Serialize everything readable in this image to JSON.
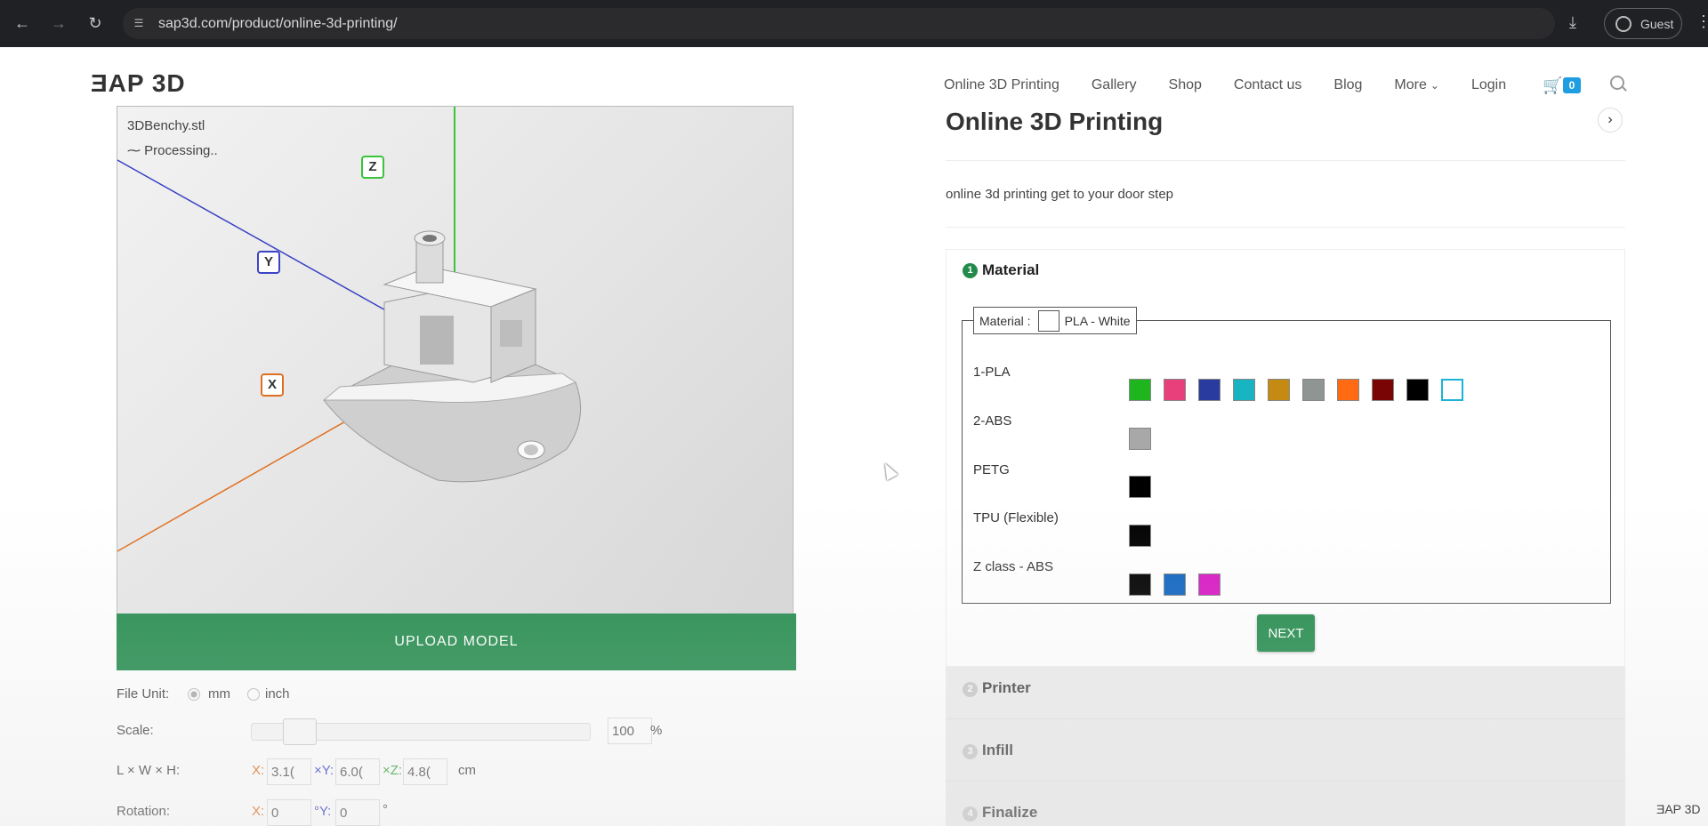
{
  "browser": {
    "url": "sap3d.com/product/online-3d-printing/",
    "profile_label": "Guest"
  },
  "site": {
    "logo": "ƎAP 3D",
    "nav": [
      "Online 3D Printing",
      "Gallery",
      "Shop",
      "Contact us",
      "Blog",
      "More",
      "Login"
    ],
    "cart_count": "0",
    "watermark": "ƎAP 3D"
  },
  "viewer": {
    "file_name": "3DBenchy.stl",
    "status": "Processing..",
    "axis_x": "X",
    "axis_y": "Y",
    "axis_z": "Z",
    "axis_colors": {
      "x": "#e07020",
      "y": "#3a44c4",
      "z": "#3ac43a"
    },
    "upload_label": "UPLOAD MODEL"
  },
  "settings": {
    "file_unit_label": "File Unit:",
    "unit_mm": "mm",
    "unit_inch": "inch",
    "selected_unit": "mm",
    "scale_label": "Scale:",
    "scale_value": "100",
    "scale_unit": "%",
    "dims_label": "L × W × H:",
    "x_prefix": "X:",
    "y_prefix": "×Y:",
    "z_prefix": "×Z:",
    "dim_x": "3.1(",
    "dim_y": "6.0(",
    "dim_z": "4.8(",
    "dim_unit": "cm",
    "rotation_label": "Rotation:",
    "rot_x_prefix": "X:",
    "rot_y_prefix": "°Y:",
    "rot_x": "0",
    "rot_y": "0",
    "rot_unit": "°"
  },
  "product": {
    "title": "Online 3D Printing",
    "description": "online 3d printing get to your door step"
  },
  "material_step": {
    "number": "1",
    "title": "Material",
    "legend_label": "Material :",
    "legend_value": "PLA - White",
    "groups": [
      {
        "name": "1-PLA",
        "colors": [
          "#1fb51f",
          "#e8407a",
          "#2a3ba0",
          "#19b4c2",
          "#c48a12",
          "#8e9592",
          "#ff6a13",
          "#7a0505",
          "#000000",
          "#ffffff"
        ]
      },
      {
        "name": "2-ABS",
        "colors": [
          "#a8a8a8"
        ]
      },
      {
        "name": "PETG",
        "colors": [
          "#000000"
        ]
      },
      {
        "name": "TPU (Flexible)",
        "colors": [
          "#000000"
        ]
      },
      {
        "name": "Z class - ABS",
        "colors": [
          "#000000",
          "#1066c2",
          "#d818c4"
        ]
      }
    ],
    "selected_color": "#ffffff",
    "next_label": "NEXT"
  },
  "steps": [
    {
      "number": "2",
      "title": "Printer"
    },
    {
      "number": "3",
      "title": "Infill"
    },
    {
      "number": "4",
      "title": "Finalize"
    }
  ]
}
